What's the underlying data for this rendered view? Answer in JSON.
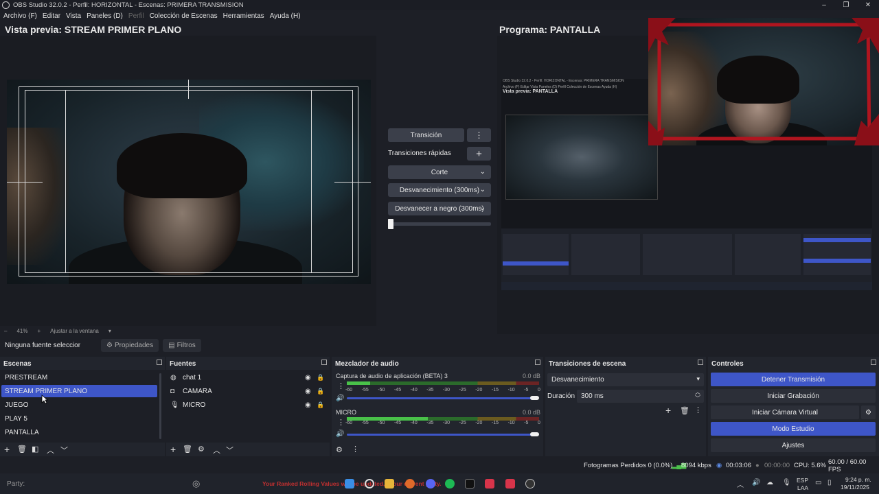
{
  "window": {
    "title": "OBS Studio 32.0.2 - Perfil: HORIZONTAL - Escenas: PRIMERA TRANSMISION",
    "controls": [
      "–",
      "❐",
      "✕"
    ]
  },
  "menu": {
    "items": [
      "Archivo (F)",
      "Editar",
      "Vista",
      "Paneles (D)",
      "Perfil",
      "Colección de Escenas",
      "Herramientas",
      "Ayuda (H)"
    ]
  },
  "preview": {
    "header": "Vista previa: STREAM PRIMER PLANO",
    "zoom_minus": "–",
    "zoom_value": "41%",
    "zoom_plus": "+",
    "fit_label": "Ajustar a la ventana"
  },
  "program": {
    "header": "Programa: PANTALLA",
    "mini_title": "OBS Studio 32.0.2 - Perfil: HORIZONTAL - Escenas: PRIMERA TRANSMISION",
    "mini_menu": "Archivo (F)   Editar   Vista   Paneles (D)   Perfil   Colección de Escenas   Ayuda (H)",
    "mini_header": "Vista previa: PANTALLA"
  },
  "transitions_center": {
    "transition_button": "Transición",
    "quick_label": "Transiciones rápidas",
    "options": [
      "Corte",
      "Desvanecimiento (300ms)",
      "Desvanecer a negro (300ms)"
    ]
  },
  "source_toolbar": {
    "no_source": "Ninguna fuente seleccionada",
    "properties": "Propiedades",
    "filters": "Filtros"
  },
  "scenes": {
    "title": "Escenas",
    "items": [
      "PRESTREAM",
      "STREAM PRIMER PLANO",
      "JUEGO",
      "PLAY 5",
      "PANTALLA"
    ],
    "selected": "STREAM PRIMER PLANO"
  },
  "sources": {
    "title": "Fuentes",
    "items": [
      {
        "name": "chat 1",
        "icon": "globe-icon"
      },
      {
        "name": "CAMARA",
        "icon": "camera-icon"
      },
      {
        "name": "MICRO",
        "icon": "microphone-icon"
      }
    ]
  },
  "mixer": {
    "title": "Mezclador de audio",
    "channels": [
      {
        "name": "Captura de audio de aplicación (BETA) 3",
        "db": "0.0 dB",
        "level": 0.12
      },
      {
        "name": "MICRO",
        "db": "0.0 dB",
        "level": 0.42
      }
    ],
    "scale": [
      "-60",
      "-55",
      "-50",
      "-45",
      "-40",
      "-35",
      "-30",
      "-25",
      "-20",
      "-15",
      "-10",
      "-5",
      "0"
    ]
  },
  "scene_transitions": {
    "title": "Transiciones de escena",
    "selected": "Desvanecimiento",
    "duration_label": "Duración",
    "duration_value": "300 ms"
  },
  "controls": {
    "title": "Controles",
    "buttons": [
      "Detener Transmisión",
      "Iniciar Grabación",
      "Iniciar Cámara Virtual",
      "Modo Estudio",
      "Ajustes"
    ]
  },
  "status": {
    "dropped_frames": "Fotogramas Perdidos 0 (0.0%)",
    "bitrate": "8094 kbps",
    "stream_time": "00:03:06",
    "rec_time": "00:00:00",
    "cpu": "CPU: 5.6%",
    "fps": "60.00 / 60.00 FPS"
  },
  "taskbar": {
    "party": "Party:",
    "ticker": "Your Ranked Rolling Values will be updated... your current party.",
    "lang": "ESP",
    "lang_sub": "LAA",
    "time": "9:24 p. m.",
    "date": "19/11/2025"
  },
  "colors": {
    "accent": "#3e56c8",
    "background": "#1d1f26",
    "frame_red": "#b0151f"
  }
}
